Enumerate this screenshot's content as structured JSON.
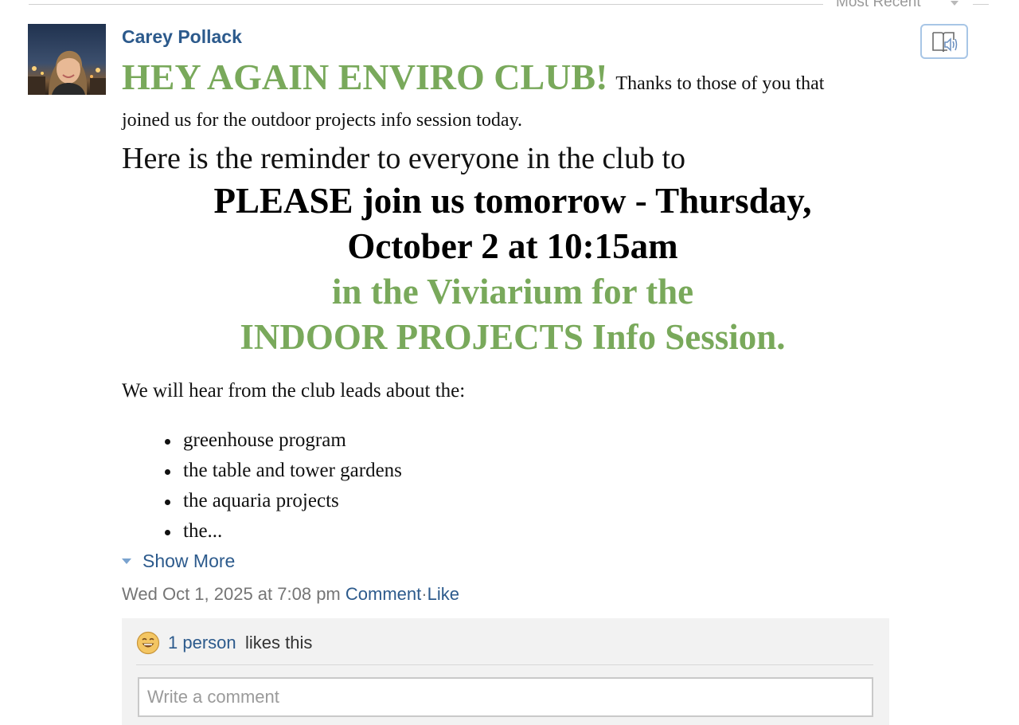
{
  "sort": {
    "label": "Most Recent"
  },
  "post": {
    "author": "Carey Pollack",
    "headline": "HEY AGAIN ENVIRO CLUB!",
    "intro_a": "Thanks to those of you that",
    "intro_b": "joined us for the outdoor projects info session today.",
    "reminder": "Here is the reminder to everyone in the club to",
    "center_lines": [
      "PLEASE join us tomorrow - Thursday,",
      "October 2 at 10:15am",
      "in the Viviarium for the",
      "INDOOR PROJECTS Info Session."
    ],
    "hear": "We will hear from the club leads about the:",
    "bullets": [
      "greenhouse program",
      "the table and tower gardens",
      "the aquaria projects",
      "the..."
    ],
    "show_more": "Show More"
  },
  "meta": {
    "timestamp": "Wed Oct 1, 2025 at 7:08 pm",
    "comment_label": "Comment",
    "separator": "·",
    "like_label": "Like"
  },
  "feedback": {
    "likes_count": "1 person",
    "likes_text": "likes this",
    "comment_placeholder": "Write a comment"
  },
  "colors": {
    "accent_green": "#79a95b",
    "link_blue": "#2c5a8c",
    "feedback_bg": "#f2f2f2"
  },
  "icons": {
    "read_aloud": "read-aloud-icon",
    "like_reaction": "smiley-icon",
    "sort_caret": "chevron-down-icon",
    "show_more_caret": "triangle-down-icon"
  }
}
